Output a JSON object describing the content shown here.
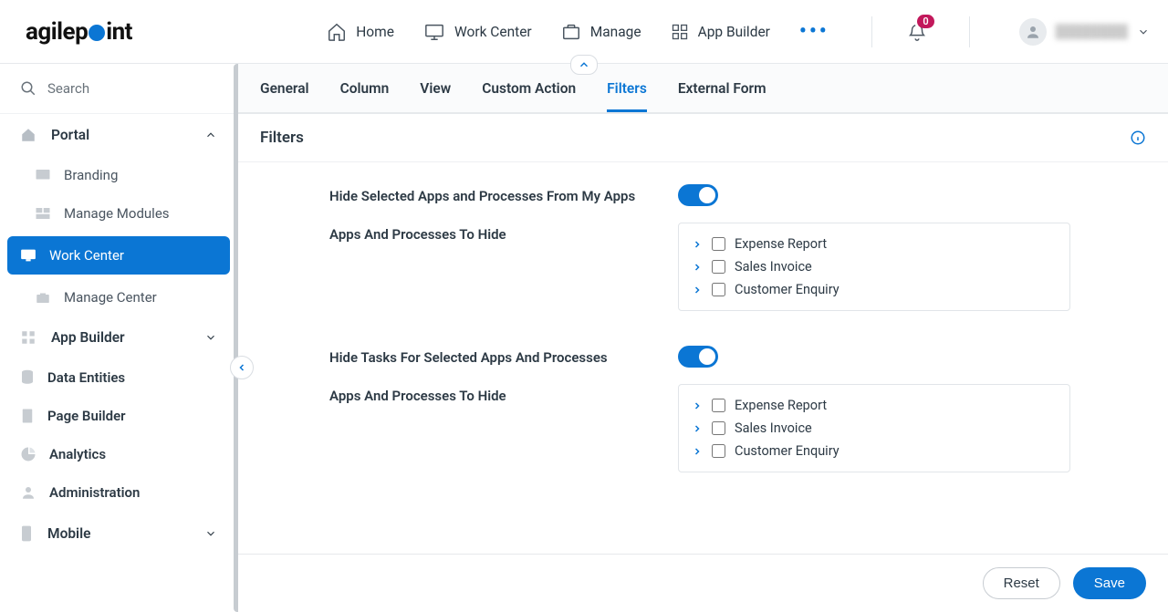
{
  "nav": {
    "items": [
      "Home",
      "Work Center",
      "Manage",
      "App Builder"
    ],
    "notifications": "0"
  },
  "sidebar": {
    "search_placeholder": "Search",
    "groups": {
      "portal": {
        "label": "Portal",
        "items": [
          "Branding",
          "Manage Modules",
          "Work Center",
          "Manage Center"
        ]
      },
      "appbuilder": {
        "label": "App Builder"
      },
      "other": [
        "Data Entities",
        "Page Builder",
        "Analytics",
        "Administration"
      ],
      "mobile": {
        "label": "Mobile"
      }
    }
  },
  "tabs": [
    "General",
    "Column",
    "View",
    "Custom Action",
    "Filters",
    "External Form"
  ],
  "panel": {
    "title": "Filters",
    "section1": {
      "toggle_label": "Hide Selected Apps and Processes From My Apps",
      "list_label": "Apps And Processes To Hide",
      "items": [
        "Expense Report",
        "Sales Invoice",
        "Customer Enquiry"
      ]
    },
    "section2": {
      "toggle_label": "Hide Tasks For Selected Apps And Processes",
      "list_label": "Apps And Processes To Hide",
      "items": [
        "Expense Report",
        "Sales Invoice",
        "Customer Enquiry"
      ]
    }
  },
  "footer": {
    "reset": "Reset",
    "save": "Save"
  }
}
